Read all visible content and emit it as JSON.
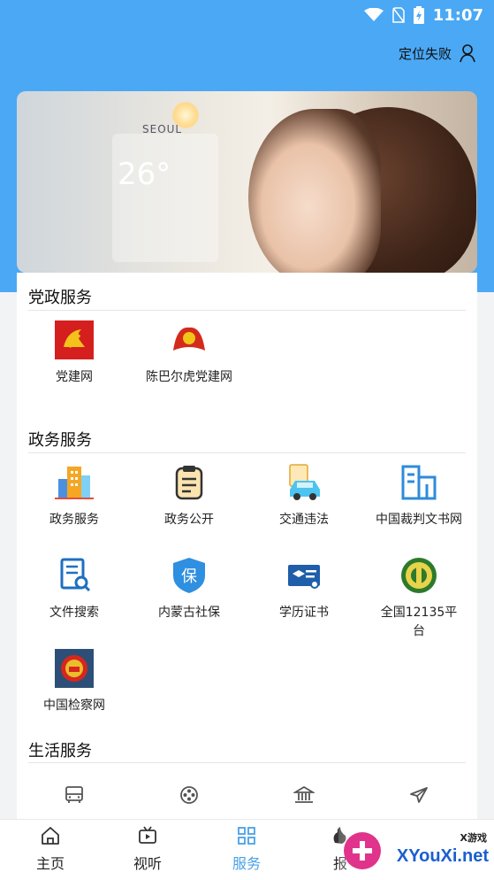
{
  "status_bar": {
    "time": "11:07"
  },
  "header": {
    "location_label": "定位失败"
  },
  "banner": {
    "city": "SEOUL",
    "temperature": "26°"
  },
  "sections": [
    {
      "title": "党政服务",
      "items": [
        {
          "label": "党建网",
          "icon": "party-emblem-icon"
        },
        {
          "label": "陈巴尔虎党建网",
          "icon": "party-flag-icon"
        }
      ]
    },
    {
      "title": "政务服务",
      "items": [
        {
          "label": "政务服务",
          "icon": "building-icon"
        },
        {
          "label": "政务公开",
          "icon": "clipboard-icon"
        },
        {
          "label": "交通违法",
          "icon": "car-icon"
        },
        {
          "label": "中国裁判文书网",
          "icon": "court-building-icon"
        },
        {
          "label": "文件搜索",
          "icon": "file-search-icon"
        },
        {
          "label": "内蒙古社保",
          "icon": "insurance-shield-icon"
        },
        {
          "label": "学历证书",
          "icon": "certificate-icon"
        },
        {
          "label": "全国12135平台",
          "icon": "badge-emblem-icon"
        },
        {
          "label": "中国检察网",
          "icon": "national-emblem-icon"
        }
      ]
    },
    {
      "title": "生活服务",
      "items": [
        {
          "label": "",
          "icon": "bus-icon"
        },
        {
          "label": "",
          "icon": "film-reel-icon"
        },
        {
          "label": "",
          "icon": "bank-icon"
        },
        {
          "label": "",
          "icon": "plane-icon"
        }
      ]
    }
  ],
  "bottom_nav": [
    {
      "label": "主页",
      "icon": "home-icon"
    },
    {
      "label": "视听",
      "icon": "video-icon"
    },
    {
      "label": "服务",
      "icon": "grid-icon",
      "active": true
    },
    {
      "label": "报",
      "icon": "news-icon"
    }
  ],
  "watermark": {
    "small": "X游戏",
    "big": "XYouXi.net"
  },
  "colors": {
    "header_bg": "#4aa8f5",
    "active_nav": "#4aa0e6"
  }
}
